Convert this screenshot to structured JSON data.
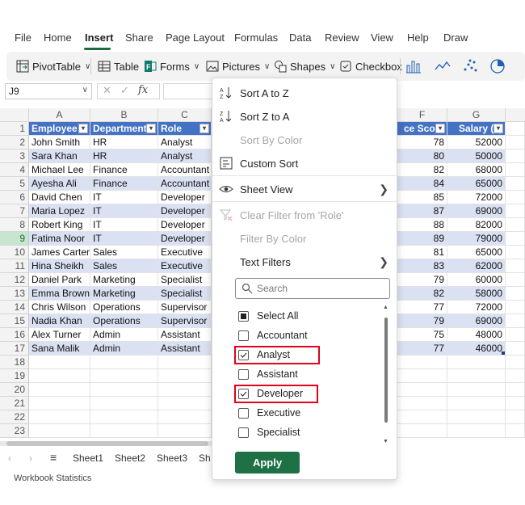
{
  "menu": [
    "File",
    "Home",
    "Insert",
    "Share",
    "Page Layout",
    "Formulas",
    "Data",
    "Review",
    "View",
    "Help",
    "Draw"
  ],
  "toolbar": {
    "pivottable": "PivotTable",
    "table": "Table",
    "forms": "Forms",
    "pictures": "Pictures",
    "shapes": "Shapes",
    "checkbox": "Checkbox"
  },
  "formula_bar": {
    "namebox": "J9",
    "fx": "fx"
  },
  "columns": [
    "A",
    "B",
    "C",
    "F",
    "G"
  ],
  "headers": {
    "a": "Employee",
    "b": "Department",
    "c": "Role",
    "f": "ce Score",
    "g": "Salary ($)"
  },
  "rows": [
    {
      "n": "1"
    },
    {
      "n": "2",
      "a": "John Smith",
      "b": "HR",
      "c": "Analyst",
      "f": "78",
      "g": "52000"
    },
    {
      "n": "3",
      "a": "Sara Khan",
      "b": "HR",
      "c": "Analyst",
      "f": "80",
      "g": "50000"
    },
    {
      "n": "4",
      "a": "Michael Lee",
      "b": "Finance",
      "c": "Accountant",
      "f": "82",
      "g": "68000"
    },
    {
      "n": "5",
      "a": "Ayesha Ali",
      "b": "Finance",
      "c": "Accountant",
      "f": "84",
      "g": "65000"
    },
    {
      "n": "6",
      "a": "David Chen",
      "b": "IT",
      "c": "Developer",
      "f": "85",
      "g": "72000"
    },
    {
      "n": "7",
      "a": "Maria Lopez",
      "b": "IT",
      "c": "Developer",
      "f": "87",
      "g": "69000"
    },
    {
      "n": "8",
      "a": "Robert King",
      "b": "IT",
      "c": "Developer",
      "f": "88",
      "g": "82000"
    },
    {
      "n": "9",
      "a": "Fatima Noor",
      "b": "IT",
      "c": "Developer",
      "f": "89",
      "g": "79000"
    },
    {
      "n": "10",
      "a": "James Carter",
      "b": "Sales",
      "c": "Executive",
      "f": "81",
      "g": "65000"
    },
    {
      "n": "11",
      "a": "Hina Sheikh",
      "b": "Sales",
      "c": "Executive",
      "f": "83",
      "g": "62000"
    },
    {
      "n": "12",
      "a": "Daniel Park",
      "b": "Marketing",
      "c": "Specialist",
      "f": "79",
      "g": "60000"
    },
    {
      "n": "13",
      "a": "Emma Brown",
      "b": "Marketing",
      "c": "Specialist",
      "f": "82",
      "g": "58000"
    },
    {
      "n": "14",
      "a": "Chris Wilson",
      "b": "Operations",
      "c": "Supervisor",
      "f": "77",
      "g": "72000"
    },
    {
      "n": "15",
      "a": "Nadia Khan",
      "b": "Operations",
      "c": "Supervisor",
      "f": "79",
      "g": "69000"
    },
    {
      "n": "16",
      "a": "Alex Turner",
      "b": "Admin",
      "c": "Assistant",
      "f": "75",
      "g": "48000"
    },
    {
      "n": "17",
      "a": "Sana Malik",
      "b": "Admin",
      "c": "Assistant",
      "f": "77",
      "g": "46000"
    },
    {
      "n": "18"
    },
    {
      "n": "19"
    },
    {
      "n": "20"
    },
    {
      "n": "21"
    },
    {
      "n": "22"
    },
    {
      "n": "23"
    }
  ],
  "selected_row": "9",
  "sheets": [
    "Sheet1",
    "Sheet2",
    "Sheet3",
    "Sh"
  ],
  "status": "Workbook Statistics",
  "dropdown": {
    "sort_az": "Sort A to Z",
    "sort_za": "Sort Z to A",
    "sort_color": "Sort By Color",
    "custom_sort": "Custom Sort",
    "sheet_view": "Sheet View",
    "clear_filter": "Clear Filter from 'Role'",
    "filter_color": "Filter By Color",
    "text_filters": "Text Filters",
    "search_placeholder": "Search",
    "options": [
      {
        "label": "Select All",
        "state": "partial"
      },
      {
        "label": "Accountant",
        "state": "unchecked"
      },
      {
        "label": "Analyst",
        "state": "checked"
      },
      {
        "label": "Assistant",
        "state": "unchecked"
      },
      {
        "label": "Developer",
        "state": "checked"
      },
      {
        "label": "Executive",
        "state": "unchecked"
      },
      {
        "label": "Specialist",
        "state": "unchecked"
      }
    ],
    "apply": "Apply"
  },
  "colors": {
    "accent": "#1e7145",
    "header_fill": "#4472c4",
    "band_fill": "#d9e1f2",
    "highlight": "#e2001a"
  }
}
